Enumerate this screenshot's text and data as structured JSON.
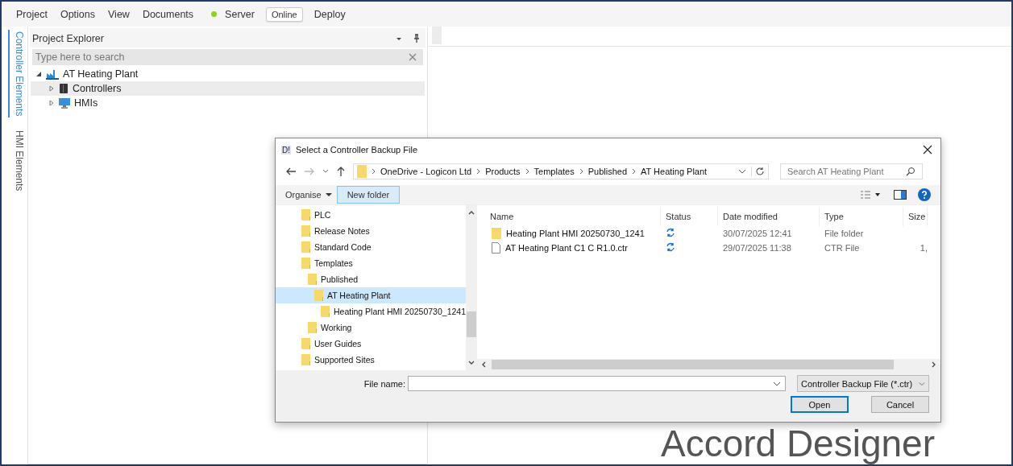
{
  "menu_bar": {
    "items": [
      "Project",
      "Options",
      "View",
      "Documents"
    ],
    "server": {
      "label": "Server",
      "connected": true
    },
    "online_button": "Online",
    "deploy": "Deploy"
  },
  "side_tabs": [
    {
      "label": "Controller Elements",
      "selected": true
    },
    {
      "label": "HMI Elements",
      "selected": false
    }
  ],
  "project_explorer": {
    "title": "Project Explorer",
    "search": {
      "placeholder": "Type here to search"
    },
    "tree": [
      {
        "label": "AT Heating Plant",
        "kind": "plant",
        "expanded": true,
        "selected": false,
        "children": [
          {
            "label": "Controllers",
            "kind": "controller",
            "expanded": false,
            "selected": true
          },
          {
            "label": "HMIs",
            "kind": "hmi",
            "expanded": false,
            "selected": false
          }
        ]
      }
    ]
  },
  "dialog": {
    "title": "Select a Controller Backup File",
    "app_icon": "D!",
    "breadcrumb": [
      "OneDrive - Logicon Ltd",
      "Products",
      "Templates",
      "Published",
      "AT Heating Plant"
    ],
    "search": {
      "placeholder": "Search AT Heating Plant"
    },
    "toolbar": {
      "organise": "Organise",
      "new_folder": "New folder"
    },
    "nav_tree": [
      {
        "label": "PLC",
        "selected": false
      },
      {
        "label": "Release Notes",
        "selected": false
      },
      {
        "label": "Standard Code",
        "selected": false
      },
      {
        "label": "Templates",
        "selected": false,
        "children": [
          {
            "label": "Published",
            "selected": false,
            "children": [
              {
                "label": "AT Heating Plant",
                "selected": true,
                "children": [
                  {
                    "label": "Heating Plant HMI 20250730_1241",
                    "selected": false
                  }
                ]
              }
            ]
          },
          {
            "label": "Working",
            "selected": false
          }
        ]
      },
      {
        "label": "User Guides",
        "selected": false
      },
      {
        "label": "Supported Sites",
        "selected": false
      }
    ],
    "columns": [
      "Name",
      "Status",
      "Date modified",
      "Type",
      "Size"
    ],
    "files": [
      {
        "kind": "folder",
        "name": "Heating Plant HMI 20250730_1241",
        "date": "30/07/2025 12:41",
        "type": "File folder"
      },
      {
        "kind": "file",
        "name": "AT Heating Plant C1 C R1.0.ctr",
        "date": "29/07/2025 11:38",
        "type": "CTR File",
        "size": "1,"
      }
    ],
    "file_name_label": "File name:",
    "file_type": "Controller Backup File (*.ctr)",
    "open": "Open",
    "cancel": "Cancel"
  },
  "logo_text": "Accord Designer"
}
